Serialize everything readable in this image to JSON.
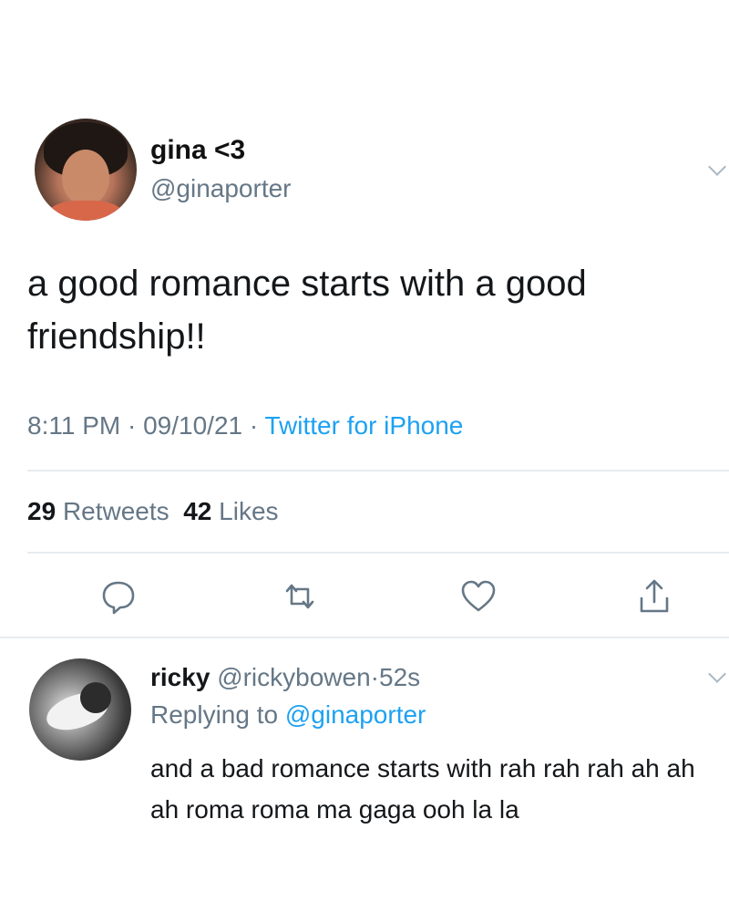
{
  "tweet": {
    "author": {
      "display_name": "gina <3",
      "handle": "@ginaporter"
    },
    "text": "a good romance starts with a good friendship!!",
    "time": "8:11 PM",
    "date": "09/10/21",
    "source": "Twitter for iPhone",
    "separator": " · ",
    "retweets_count": "29",
    "retweets_label": "Retweets",
    "likes_count": "42",
    "likes_label": "Likes",
    "actions": [
      "reply-icon",
      "retweet-icon",
      "like-icon",
      "share-icon"
    ]
  },
  "reply": {
    "author": {
      "display_name": "ricky",
      "handle": "@rickybowen",
      "age": "52s"
    },
    "replying_to_label": "Replying to",
    "replying_to_handle": "@ginaporter",
    "text": "and a bad romance starts with rah rah rah ah ah ah roma roma ma gaga ooh la la"
  },
  "colors": {
    "link": "#1da1f2",
    "secondary_text": "#657786",
    "primary_text": "#14171a",
    "divider": "#e6ecf0"
  }
}
